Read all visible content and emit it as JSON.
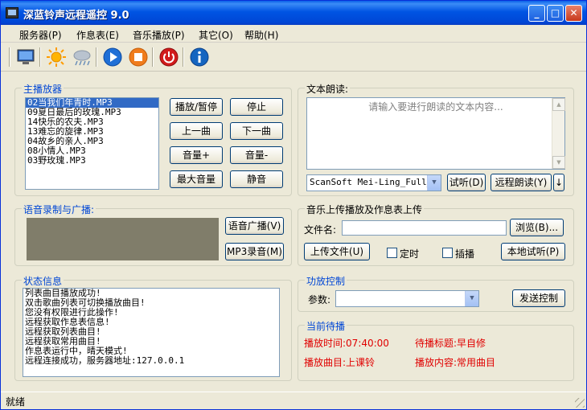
{
  "window": {
    "title": "深蓝铃声远程遥控 9.0"
  },
  "menu": [
    "服务器(P)",
    "作息表(E)",
    "音乐播放(P)",
    "其它(O)",
    "帮助(H)"
  ],
  "toolbar_icons": [
    "monitor-icon",
    "sun-icon",
    "cloud-rain-icon",
    "play-icon",
    "stop-icon",
    "power-icon",
    "info-icon"
  ],
  "main_player": {
    "title": "主播放器",
    "playlist": [
      "02当我们年青时.MP3",
      "09夏日最后的玫瑰.MP3",
      "14快乐的农夫.MP3",
      "13难忘的旋律.MP3",
      "04故乡的亲人.MP3",
      "08小情人.MP3",
      "03野玫瑰.MP3"
    ],
    "selected_index": 0,
    "buttons": {
      "play_pause": "播放/暂停",
      "stop": "停止",
      "prev": "上一曲",
      "next": "下一曲",
      "vol_up": "音量+",
      "vol_down": "音量-",
      "max_vol": "最大音量",
      "mute": "静音"
    }
  },
  "tts": {
    "title": "文本朗读:",
    "placeholder": "请输入要进行朗读的文本内容...",
    "voice": "ScanSoft Mei-Ling_Full_22kHz",
    "listen": "试听(D)",
    "remote_read": "远程朗读(Y)",
    "arrow": "↓"
  },
  "voice_broadcast": {
    "title": "语音录制与广播:",
    "broadcast": "语音广播(V)",
    "mp3_record": "MP3录音(M)"
  },
  "upload": {
    "title": "音乐上传播放及作息表上传",
    "filename_label": "文件名:",
    "browse": "浏览(B)...",
    "upload_file": "上传文件(U)",
    "timed": "定时",
    "insert": "插播",
    "local_listen": "本地试听(P)"
  },
  "status_info": {
    "title": "状态信息",
    "lines": [
      "列表曲目播放成功!",
      "双击歌曲列表可切换播放曲目!",
      "您没有权限进行此操作!",
      "远程获取作息表信息!",
      "远程获取列表曲目!",
      "远程获取常用曲目!",
      "作息表运行中，晴天模式!",
      "远程连接成功，服务器地址:127.0.0.1"
    ]
  },
  "amp": {
    "title": "功放控制",
    "param_label": "参数:",
    "send": "发送控制"
  },
  "waiting": {
    "title": "当前待播",
    "time_label": "播放时间:07:40:00",
    "title_label": "待播标题:早自修",
    "song_label": "播放曲目:上课铃",
    "content_label": "播放内容:常用曲目"
  },
  "statusbar": {
    "text": "就绪"
  },
  "colors": {
    "accent": "#0046d5",
    "highlight": "#e00000",
    "selection": "#316ac5"
  }
}
